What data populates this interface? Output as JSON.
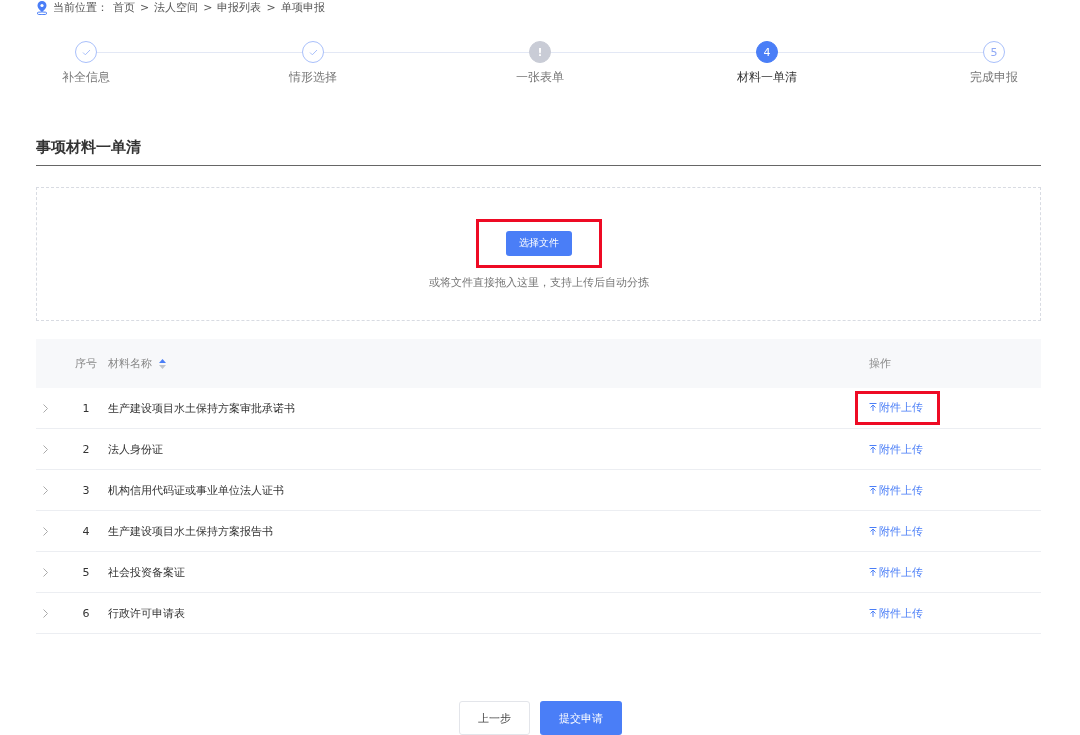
{
  "breadcrumb": {
    "label": "当前位置：",
    "items": [
      "首页",
      "法人空间",
      "申报列表",
      "单项申报"
    ],
    "separator": ">"
  },
  "steps": [
    {
      "label": "补全信息",
      "kind": "done"
    },
    {
      "label": "情形选择",
      "kind": "done"
    },
    {
      "label": "一张表单",
      "kind": "error",
      "mark": "!"
    },
    {
      "label": "材料一单清",
      "kind": "current",
      "mark": "4"
    },
    {
      "label": "完成申报",
      "kind": "pending",
      "mark": "5"
    }
  ],
  "section_title": "事项材料一单清",
  "upload": {
    "button": "选择文件",
    "hint": "或将文件直接拖入这里，支持上传后自动分拣",
    "highlighted": true
  },
  "table": {
    "columns": [
      "序号",
      "材料名称",
      "操作"
    ],
    "rows": [
      {
        "index": "1",
        "name": "生产建设项目水土保持方案审批承诺书",
        "action": "附件上传",
        "highlighted": true
      },
      {
        "index": "2",
        "name": "法人身份证",
        "action": "附件上传",
        "highlighted": false
      },
      {
        "index": "3",
        "name": "机构信用代码证或事业单位法人证书",
        "action": "附件上传",
        "highlighted": false
      },
      {
        "index": "4",
        "name": "生产建设项目水土保持方案报告书",
        "action": "附件上传",
        "highlighted": false
      },
      {
        "index": "5",
        "name": "社会投资备案证",
        "action": "附件上传",
        "highlighted": false
      },
      {
        "index": "6",
        "name": "行政许可申请表",
        "action": "附件上传",
        "highlighted": false
      }
    ]
  },
  "buttons": [
    {
      "label": "上一步",
      "kind": "secondary"
    },
    {
      "label": "提交申请",
      "kind": "primary"
    }
  ]
}
